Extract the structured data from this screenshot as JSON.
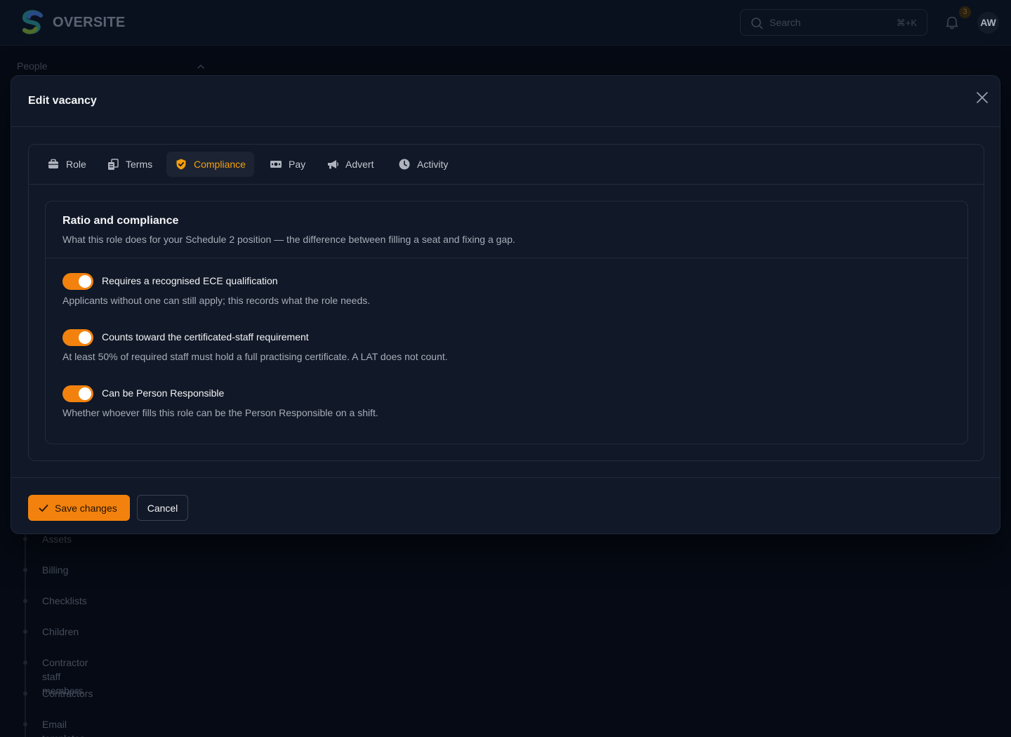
{
  "app": {
    "brand": "OVERSITE",
    "search_placeholder": "Search",
    "search_shortcut": "⌘+K",
    "notification_count": "3",
    "user_initials": "AW"
  },
  "sidebar": {
    "section_label": "People",
    "items": [
      "Assets",
      "Billing",
      "Checklists",
      "Children",
      "Contractor staff members",
      "Contractors",
      "Email templates"
    ]
  },
  "modal": {
    "title": "Edit vacancy",
    "tabs": [
      {
        "label": "Role",
        "icon": "briefcase-icon"
      },
      {
        "label": "Terms",
        "icon": "documents-icon"
      },
      {
        "label": "Compliance",
        "icon": "shield-check-icon",
        "active": true
      },
      {
        "label": "Pay",
        "icon": "banknote-icon"
      },
      {
        "label": "Advert",
        "icon": "megaphone-icon"
      },
      {
        "label": "Activity",
        "icon": "clock-icon"
      }
    ],
    "section": {
      "title": "Ratio and compliance",
      "description": "What this role does for your Schedule 2 position — the difference between filling a seat and fixing a gap."
    },
    "toggles": [
      {
        "label": "Requires a recognised ECE qualification",
        "help": "Applicants without one can still apply; this records what the role needs.",
        "on": true
      },
      {
        "label": "Counts toward the certificated-staff requirement",
        "help": "At least 50% of required staff must hold a full practising certificate. A LAT does not count.",
        "on": true
      },
      {
        "label": "Can be Person Responsible",
        "help": "Whether whoever fills this role can be the Person Responsible on a shift.",
        "on": true
      }
    ],
    "footer": {
      "save_label": "Save changes",
      "cancel_label": "Cancel"
    }
  },
  "colors": {
    "accent": "#f2820d",
    "active_tab_text": "#f59e0b",
    "modal_bg": "#111827",
    "page_bg": "#050a14"
  }
}
